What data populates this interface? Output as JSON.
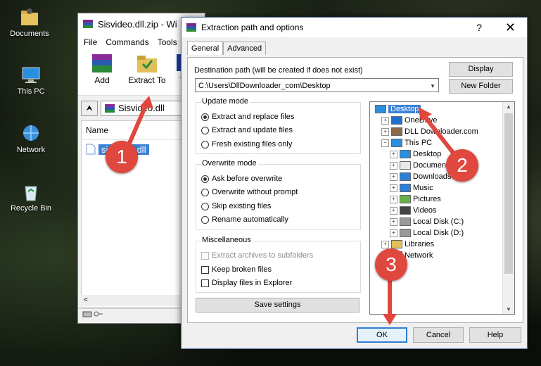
{
  "desktop": {
    "icons": [
      {
        "label": "Documents",
        "icon": "documents-folder-icon"
      },
      {
        "label": "This PC",
        "icon": "computer-icon"
      },
      {
        "label": "Network",
        "icon": "network-icon"
      },
      {
        "label": "Recycle Bin",
        "icon": "recycle-bin-icon"
      }
    ]
  },
  "winrar": {
    "title": "Sisvideo.dll.zip - Wi",
    "menu": [
      "File",
      "Commands",
      "Tools"
    ],
    "toolbar": {
      "add_label": "Add",
      "extract_label": "Extract To",
      "third_label": "T"
    },
    "address_path": "Sisvideo.dll",
    "list_header": "Name",
    "file_name": "sisvideo.dll"
  },
  "dialog": {
    "title": "Extraction path and options",
    "help_glyph": "?",
    "close_glyph": "✕",
    "tabs": [
      {
        "label": "General",
        "active": true
      },
      {
        "label": "Advanced",
        "active": false
      }
    ],
    "destination_label": "Destination path (will be created if does not exist)",
    "destination_value": "C:\\Users\\DllDownloader_com\\Desktop",
    "display_button": "Display",
    "new_folder_button": "New Folder",
    "update_mode": {
      "title": "Update mode",
      "options": [
        {
          "label": "Extract and replace files",
          "selected": true
        },
        {
          "label": "Extract and update files",
          "selected": false
        },
        {
          "label": "Fresh existing files only",
          "selected": false
        }
      ]
    },
    "overwrite_mode": {
      "title": "Overwrite mode",
      "options": [
        {
          "label": "Ask before overwrite",
          "selected": true
        },
        {
          "label": "Overwrite without prompt",
          "selected": false
        },
        {
          "label": "Skip existing files",
          "selected": false
        },
        {
          "label": "Rename automatically",
          "selected": false
        }
      ]
    },
    "misc": {
      "title": "Miscellaneous",
      "options": [
        {
          "label": "Extract archives to subfolders",
          "checked": false,
          "disabled": true
        },
        {
          "label": "Keep broken files",
          "checked": false,
          "disabled": false
        },
        {
          "label": "Display files in Explorer",
          "checked": false,
          "disabled": false
        }
      ]
    },
    "save_settings": "Save settings",
    "tree": [
      {
        "label": "Desktop",
        "level": 0,
        "expander": "",
        "icon": "desktop-icon",
        "selected": true
      },
      {
        "label": "OneDrive",
        "level": 1,
        "expander": "+",
        "icon": "cloud-icon",
        "selected": false
      },
      {
        "label": "DLL Downloader.com",
        "level": 1,
        "expander": "+",
        "icon": "user-icon",
        "selected": false
      },
      {
        "label": "This PC",
        "level": 1,
        "expander": "−",
        "icon": "computer-icon",
        "selected": false
      },
      {
        "label": "Desktop",
        "level": 2,
        "expander": "+",
        "icon": "desktop-icon",
        "selected": false
      },
      {
        "label": "Documents",
        "level": 2,
        "expander": "+",
        "icon": "document-icon",
        "selected": false
      },
      {
        "label": "Downloads",
        "level": 2,
        "expander": "+",
        "icon": "download-icon",
        "selected": false
      },
      {
        "label": "Music",
        "level": 2,
        "expander": "+",
        "icon": "music-icon",
        "selected": false
      },
      {
        "label": "Pictures",
        "level": 2,
        "expander": "+",
        "icon": "pictures-icon",
        "selected": false
      },
      {
        "label": "Videos",
        "level": 2,
        "expander": "+",
        "icon": "videos-icon",
        "selected": false
      },
      {
        "label": "Local Disk (C:)",
        "level": 2,
        "expander": "+",
        "icon": "drive-icon",
        "selected": false
      },
      {
        "label": "Local Disk (D:)",
        "level": 2,
        "expander": "+",
        "icon": "drive-icon",
        "selected": false
      },
      {
        "label": "Libraries",
        "level": 1,
        "expander": "+",
        "icon": "library-icon",
        "selected": false
      },
      {
        "label": "Network",
        "level": 1,
        "expander": "+",
        "icon": "network-icon",
        "selected": false
      }
    ],
    "ok_button": "OK",
    "cancel_button": "Cancel",
    "help_button": "Help"
  },
  "annotations": [
    "1",
    "2",
    "3"
  ],
  "colors": {
    "accent": "#3b82d6",
    "annotation": "#e0473f",
    "arrow": "#e0473f"
  }
}
